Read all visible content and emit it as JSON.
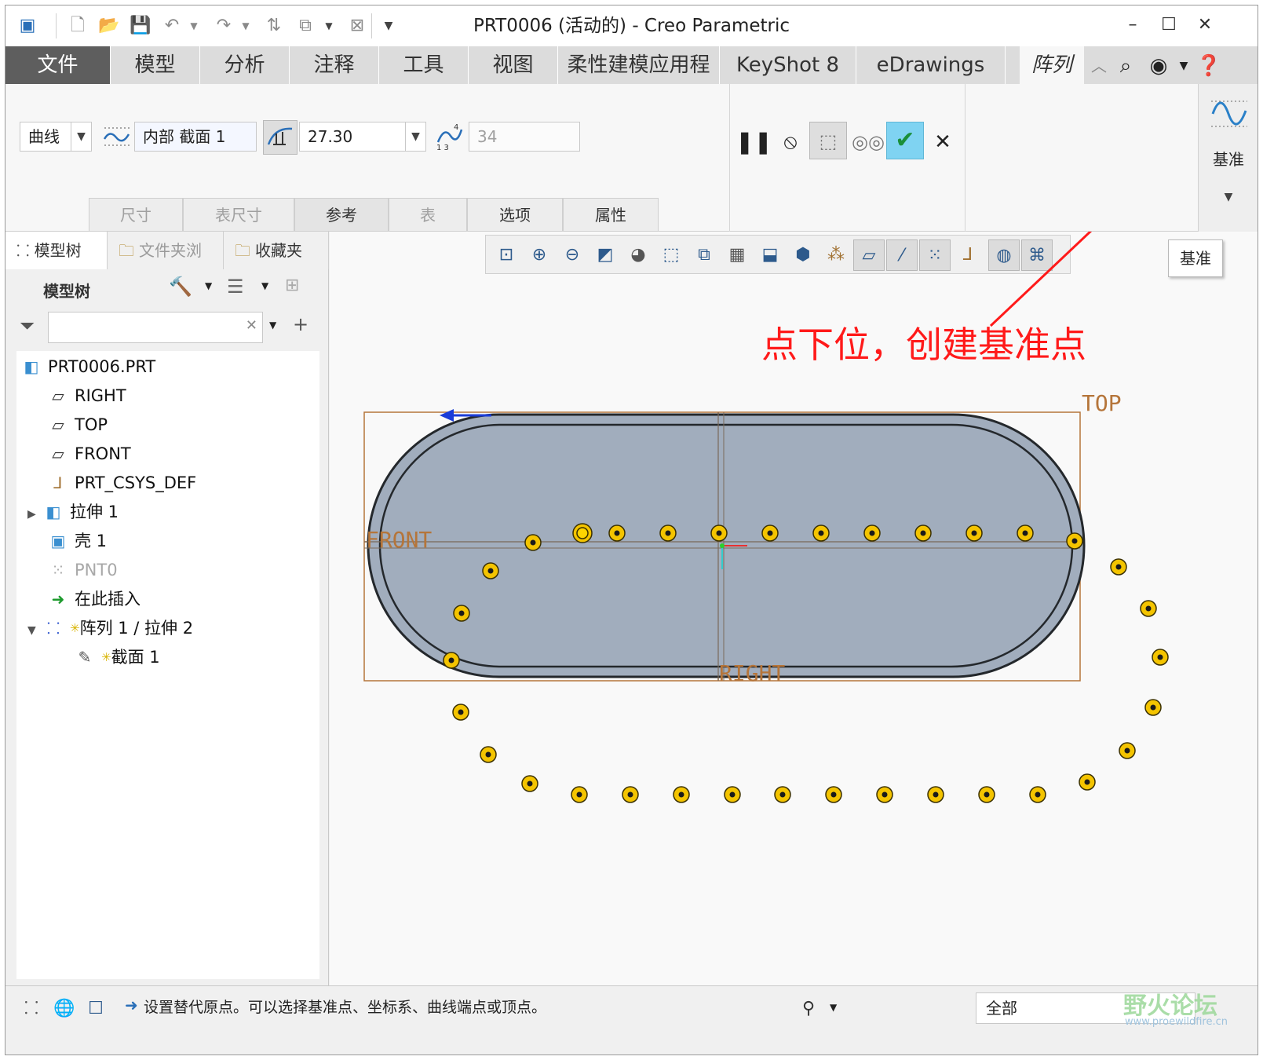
{
  "window": {
    "title": "PRT0006 (活动的) - Creo Parametric"
  },
  "ribbon": {
    "tabs": [
      "文件",
      "模型",
      "分析",
      "注释",
      "工具",
      "视图",
      "柔性建模应用程序",
      "KeyShot 8",
      "eDrawings",
      "阵列"
    ],
    "active_tab": "阵列"
  },
  "dashboard": {
    "pattern_type": "曲线",
    "reference_sketch": "内部 截面 1",
    "spacing_value": "27.30",
    "member_count": "34",
    "subtabs": [
      "尺寸",
      "表尺寸",
      "参考",
      "表",
      "选项",
      "属性"
    ],
    "datum_group_label": "基准"
  },
  "tooltip": {
    "text": "基准"
  },
  "annotation": {
    "text": "点下位，创建基准点",
    "color": "#ff1a1a"
  },
  "left_panel": {
    "tabs": [
      "模型树",
      "文件夹浏",
      "收藏夹"
    ],
    "tree_header": "模型树",
    "filter_placeholder": "",
    "tree_items": [
      {
        "label": "PRT0006.PRT",
        "icon": "part-icon"
      },
      {
        "label": "RIGHT",
        "icon": "datum-plane-icon"
      },
      {
        "label": "TOP",
        "icon": "datum-plane-icon"
      },
      {
        "label": "FRONT",
        "icon": "datum-plane-icon"
      },
      {
        "label": "PRT_CSYS_DEF",
        "icon": "csys-icon"
      },
      {
        "label": "拉伸 1",
        "icon": "extrude-icon"
      },
      {
        "label": "壳 1",
        "icon": "shell-icon"
      },
      {
        "label": "PNT0",
        "icon": "datum-point-icon"
      },
      {
        "label": "在此插入",
        "icon": "insert-here-arrow-icon"
      },
      {
        "label": "阵列 1 / 拉伸 2",
        "icon": "pattern-icon"
      },
      {
        "label": "截面 1",
        "icon": "sketch-icon"
      }
    ]
  },
  "model_labels": {
    "top": "TOP",
    "front": "FRONT",
    "right": "RIGHT"
  },
  "status_bar": {
    "message": "设置替代原点。可以选择基准点、坐标系、曲线端点或顶点。",
    "filter_value": "全部",
    "watermark": "野火论坛",
    "watermark_url": "www.proewildfire.cn"
  },
  "colors": {
    "file_tab": "#5e5e5e",
    "confirm_button": "#7fd3f2",
    "part_fill": "#a1adbd",
    "pattern_point": "#f4c400"
  }
}
